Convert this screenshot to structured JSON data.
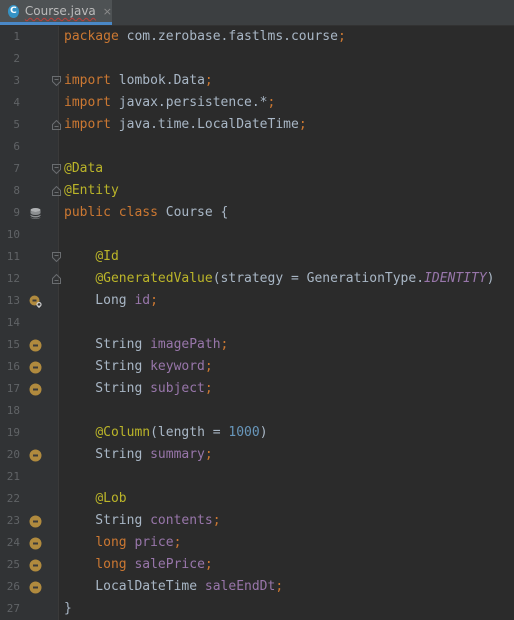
{
  "tab": {
    "title": "Course.java",
    "icon_letter": "C",
    "close": "×"
  },
  "lines": [
    {
      "n": "1",
      "gutter": "",
      "fold": "",
      "segs": [
        {
          "t": "package ",
          "c": "kw"
        },
        {
          "t": "com.zerobase.fastlms.course",
          "c": ""
        },
        {
          "t": ";",
          "c": "kw"
        }
      ]
    },
    {
      "n": "2",
      "gutter": "",
      "fold": "",
      "segs": []
    },
    {
      "n": "3",
      "gutter": "",
      "fold": "start",
      "segs": [
        {
          "t": "import ",
          "c": "kw"
        },
        {
          "t": "lombok.Data",
          "c": ""
        },
        {
          "t": ";",
          "c": "kw"
        }
      ]
    },
    {
      "n": "4",
      "gutter": "",
      "fold": "",
      "segs": [
        {
          "t": "import ",
          "c": "kw"
        },
        {
          "t": "javax.persistence.*",
          "c": ""
        },
        {
          "t": ";",
          "c": "kw"
        }
      ]
    },
    {
      "n": "5",
      "gutter": "",
      "fold": "end",
      "segs": [
        {
          "t": "import ",
          "c": "kw"
        },
        {
          "t": "java.time.LocalDateTime",
          "c": ""
        },
        {
          "t": ";",
          "c": "kw"
        }
      ]
    },
    {
      "n": "6",
      "gutter": "",
      "fold": "",
      "segs": []
    },
    {
      "n": "7",
      "gutter": "",
      "fold": "start",
      "segs": [
        {
          "t": "@Data",
          "c": "ann"
        }
      ]
    },
    {
      "n": "8",
      "gutter": "",
      "fold": "end",
      "segs": [
        {
          "t": "@Entity",
          "c": "ann"
        }
      ]
    },
    {
      "n": "9",
      "gutter": "db",
      "fold": "",
      "segs": [
        {
          "t": "public class ",
          "c": "kw"
        },
        {
          "t": "Course {",
          "c": ""
        }
      ]
    },
    {
      "n": "10",
      "gutter": "",
      "fold": "",
      "segs": []
    },
    {
      "n": "11",
      "gutter": "",
      "fold": "start",
      "segs": [
        {
          "t": "    ",
          "c": ""
        },
        {
          "t": "@Id",
          "c": "ann"
        }
      ]
    },
    {
      "n": "12",
      "gutter": "",
      "fold": "end",
      "segs": [
        {
          "t": "    ",
          "c": ""
        },
        {
          "t": "@GeneratedValue",
          "c": "ann"
        },
        {
          "t": "(strategy = GenerationType.",
          "c": ""
        },
        {
          "t": "IDENTITY",
          "c": "cst"
        },
        {
          "t": ")",
          "c": ""
        }
      ]
    },
    {
      "n": "13",
      "gutter": "key",
      "fold": "",
      "segs": [
        {
          "t": "    Long ",
          "c": ""
        },
        {
          "t": "id",
          "c": "fld"
        },
        {
          "t": ";",
          "c": "kw"
        }
      ]
    },
    {
      "n": "14",
      "gutter": "",
      "fold": "",
      "segs": []
    },
    {
      "n": "15",
      "gutter": "col",
      "fold": "",
      "segs": [
        {
          "t": "    String ",
          "c": ""
        },
        {
          "t": "imagePath",
          "c": "fld"
        },
        {
          "t": ";",
          "c": "kw"
        }
      ]
    },
    {
      "n": "16",
      "gutter": "col",
      "fold": "",
      "segs": [
        {
          "t": "    String ",
          "c": ""
        },
        {
          "t": "keyword",
          "c": "fld"
        },
        {
          "t": ";",
          "c": "kw"
        }
      ]
    },
    {
      "n": "17",
      "gutter": "col",
      "fold": "",
      "segs": [
        {
          "t": "    String ",
          "c": ""
        },
        {
          "t": "subject",
          "c": "fld"
        },
        {
          "t": ";",
          "c": "kw"
        }
      ]
    },
    {
      "n": "18",
      "gutter": "",
      "fold": "",
      "segs": []
    },
    {
      "n": "19",
      "gutter": "",
      "fold": "",
      "segs": [
        {
          "t": "    ",
          "c": ""
        },
        {
          "t": "@Column",
          "c": "ann"
        },
        {
          "t": "(length = ",
          "c": ""
        },
        {
          "t": "1000",
          "c": "num"
        },
        {
          "t": ")",
          "c": ""
        }
      ]
    },
    {
      "n": "20",
      "gutter": "col",
      "fold": "",
      "segs": [
        {
          "t": "    String ",
          "c": ""
        },
        {
          "t": "summary",
          "c": "fld"
        },
        {
          "t": ";",
          "c": "kw"
        }
      ]
    },
    {
      "n": "21",
      "gutter": "",
      "fold": "",
      "segs": []
    },
    {
      "n": "22",
      "gutter": "",
      "fold": "",
      "segs": [
        {
          "t": "    ",
          "c": ""
        },
        {
          "t": "@Lob",
          "c": "ann"
        }
      ]
    },
    {
      "n": "23",
      "gutter": "col",
      "fold": "",
      "segs": [
        {
          "t": "    String ",
          "c": ""
        },
        {
          "t": "contents",
          "c": "fld"
        },
        {
          "t": ";",
          "c": "kw"
        }
      ]
    },
    {
      "n": "24",
      "gutter": "col",
      "fold": "",
      "segs": [
        {
          "t": "    ",
          "c": ""
        },
        {
          "t": "long ",
          "c": "kw"
        },
        {
          "t": "price",
          "c": "fld"
        },
        {
          "t": ";",
          "c": "kw"
        }
      ]
    },
    {
      "n": "25",
      "gutter": "col",
      "fold": "",
      "segs": [
        {
          "t": "    ",
          "c": ""
        },
        {
          "t": "long ",
          "c": "kw"
        },
        {
          "t": "salePrice",
          "c": "fld"
        },
        {
          "t": ";",
          "c": "kw"
        }
      ]
    },
    {
      "n": "26",
      "gutter": "col",
      "fold": "",
      "segs": [
        {
          "t": "    LocalDateTime ",
          "c": ""
        },
        {
          "t": "saleEndDt",
          "c": "fld"
        },
        {
          "t": ";",
          "c": "kw"
        }
      ]
    },
    {
      "n": "27",
      "gutter": "",
      "fold": "",
      "segs": [
        {
          "t": "}",
          "c": ""
        }
      ]
    }
  ]
}
